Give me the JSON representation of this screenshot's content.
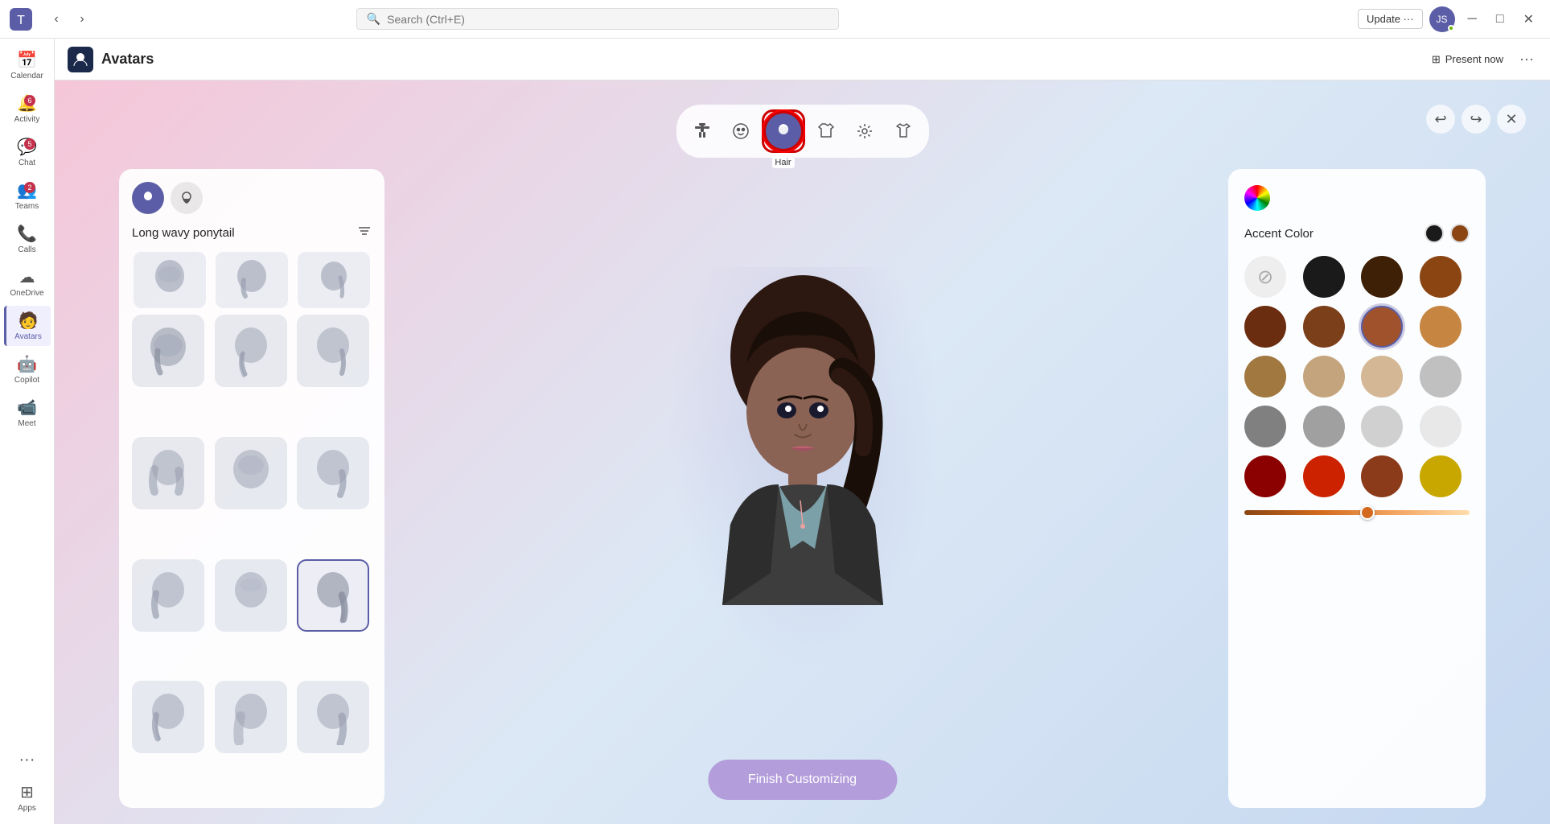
{
  "titlebar": {
    "search_placeholder": "Search (Ctrl+E)",
    "update_label": "Update ···",
    "minimize": "─",
    "maximize": "□",
    "close": "✕"
  },
  "sidebar": {
    "items": [
      {
        "id": "calendar",
        "label": "Calendar",
        "icon": "📅",
        "badge": null
      },
      {
        "id": "activity",
        "label": "Activity",
        "icon": "🔔",
        "badge": "6"
      },
      {
        "id": "chat",
        "label": "Chat",
        "icon": "💬",
        "badge": "5"
      },
      {
        "id": "teams",
        "label": "Teams",
        "icon": "👥",
        "badge": "2"
      },
      {
        "id": "calls",
        "label": "Calls",
        "icon": "📞",
        "badge": null
      },
      {
        "id": "onedrive",
        "label": "OneDrive",
        "icon": "☁",
        "badge": null
      },
      {
        "id": "avatars",
        "label": "Avatars",
        "icon": "🧑",
        "badge": null
      },
      {
        "id": "copilot",
        "label": "Copilot",
        "icon": "🤖",
        "badge": null
      },
      {
        "id": "meet",
        "label": "Meet",
        "icon": "📹",
        "badge": null
      },
      {
        "id": "more",
        "label": "···",
        "icon": "···",
        "badge": null
      },
      {
        "id": "apps",
        "label": "Apps",
        "icon": "⊞",
        "badge": null
      }
    ]
  },
  "header": {
    "app_icon": "👤",
    "app_title": "Avatars",
    "present_now_label": "Present now",
    "more_options_label": "···"
  },
  "category_tabs": [
    {
      "id": "pose",
      "icon": "🎭",
      "label": ""
    },
    {
      "id": "face",
      "icon": "😊",
      "label": ""
    },
    {
      "id": "hair",
      "icon": "👤",
      "label": "Hair",
      "active": true
    },
    {
      "id": "outfit",
      "icon": "👔",
      "label": ""
    },
    {
      "id": "accessories",
      "icon": "💎",
      "label": ""
    },
    {
      "id": "clothing",
      "icon": "👕",
      "label": ""
    }
  ],
  "editor_controls": {
    "undo_label": "↩",
    "redo_label": "↪",
    "close_label": "✕"
  },
  "hair_panel": {
    "title": "Long wavy ponytail",
    "tabs": [
      {
        "id": "hair",
        "icon": "👤",
        "active": true
      },
      {
        "id": "beard",
        "icon": "🧔",
        "active": false
      }
    ],
    "items": [
      {
        "id": 1,
        "selected": false
      },
      {
        "id": 2,
        "selected": false
      },
      {
        "id": 3,
        "selected": false
      },
      {
        "id": 4,
        "selected": false
      },
      {
        "id": 5,
        "selected": false
      },
      {
        "id": 6,
        "selected": false
      },
      {
        "id": 7,
        "selected": false
      },
      {
        "id": 8,
        "selected": false
      },
      {
        "id": 9,
        "selected": true
      },
      {
        "id": 10,
        "selected": false
      },
      {
        "id": 11,
        "selected": false
      },
      {
        "id": 12,
        "selected": false
      }
    ]
  },
  "color_panel": {
    "title": "Accent Color",
    "selected_dark": "#1a1a1a",
    "selected_brown": "#8B4513",
    "swatches": [
      {
        "id": "none",
        "color": null,
        "type": "none"
      },
      {
        "id": "black",
        "color": "#1a1a1a"
      },
      {
        "id": "dark_brown",
        "color": "#3d2006"
      },
      {
        "id": "medium_brown",
        "color": "#8B4513"
      },
      {
        "id": "red_brown1",
        "color": "#6B2D0F"
      },
      {
        "id": "red_brown2",
        "color": "#7B3F1A"
      },
      {
        "id": "tan_brown",
        "color": "#A0522D",
        "selected": true
      },
      {
        "id": "light_tan",
        "color": "#C68642"
      },
      {
        "id": "gold_brown",
        "color": "#A07840"
      },
      {
        "id": "sandy",
        "color": "#C4A47C"
      },
      {
        "id": "light_sandy",
        "color": "#D4B896"
      },
      {
        "id": "silver_gray",
        "color": "#C0C0C0"
      },
      {
        "id": "dark_gray",
        "color": "#808080"
      },
      {
        "id": "medium_gray",
        "color": "#A0A0A0"
      },
      {
        "id": "light_gray",
        "color": "#D0D0D0"
      },
      {
        "id": "white_gray",
        "color": "#E8E8E8"
      },
      {
        "id": "dark_red",
        "color": "#8B0000"
      },
      {
        "id": "red",
        "color": "#CC2200"
      },
      {
        "id": "auburn",
        "color": "#8B3A1A"
      },
      {
        "id": "golden",
        "color": "#C8A800"
      }
    ],
    "slider_value": 55
  },
  "finish_button": {
    "label": "Finish Customizing"
  }
}
